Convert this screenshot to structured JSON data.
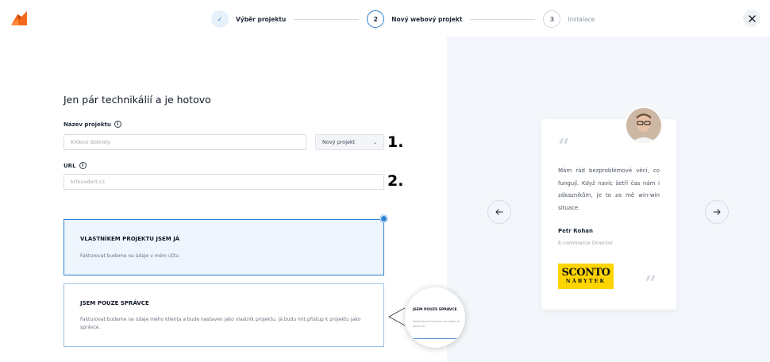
{
  "header": {
    "steps": [
      {
        "number": "✓",
        "label": "Výběr projektu",
        "state": "done"
      },
      {
        "number": "2",
        "label": "Nový webový projekt",
        "state": "active"
      },
      {
        "number": "3",
        "label": "Instalace",
        "state": "todo"
      }
    ],
    "close_icon": "close-icon",
    "logo_icon": "fox-logo-icon"
  },
  "form": {
    "heading": "Jen pár technikálií a je hotovo",
    "project_name": {
      "label": "Název projektu",
      "placeholder": "Krtkovi dobroty"
    },
    "project_type": {
      "selected": "Nový projekt"
    },
    "url": {
      "label": "URL",
      "placeholder": "krtkuvdort.cz"
    },
    "annotations": [
      "1.",
      "2."
    ]
  },
  "options": [
    {
      "title": "VLASTNÍKEM PROJEKTU JSEM JÁ",
      "description": "Fakturovat budeme na údaje v mém účtu",
      "selected": true
    },
    {
      "title": "JSEM POUZE SPRÁVCE",
      "description": "Fakturovat budeme na údaje mého klienta a bude nastaven jako vlastník projektu. Já budu mít přístup k projektu jako správce.",
      "selected": false
    }
  ],
  "magnifier": {
    "title": "JSEM POUZE SPRÁVCE",
    "description": "Fakturovat budeme na údaje m správce."
  },
  "testimonial": {
    "quote": "Mám rád bezproblémové věci, co fungují. Když navíc šetří čas nám i zákazníkům, je to za mě win-win situace.",
    "author": "Petr Rohan",
    "role": "E-commerce Director",
    "brand_top": "SCONTO",
    "brand_bottom": "NÁBYTEK"
  },
  "colors": {
    "accent": "#2f80d1",
    "selected_bg": "#eef5fd",
    "panel_bg": "#f3f6fa",
    "logo_orange": "#f26a1b",
    "brand_yellow": "#ffd500"
  }
}
